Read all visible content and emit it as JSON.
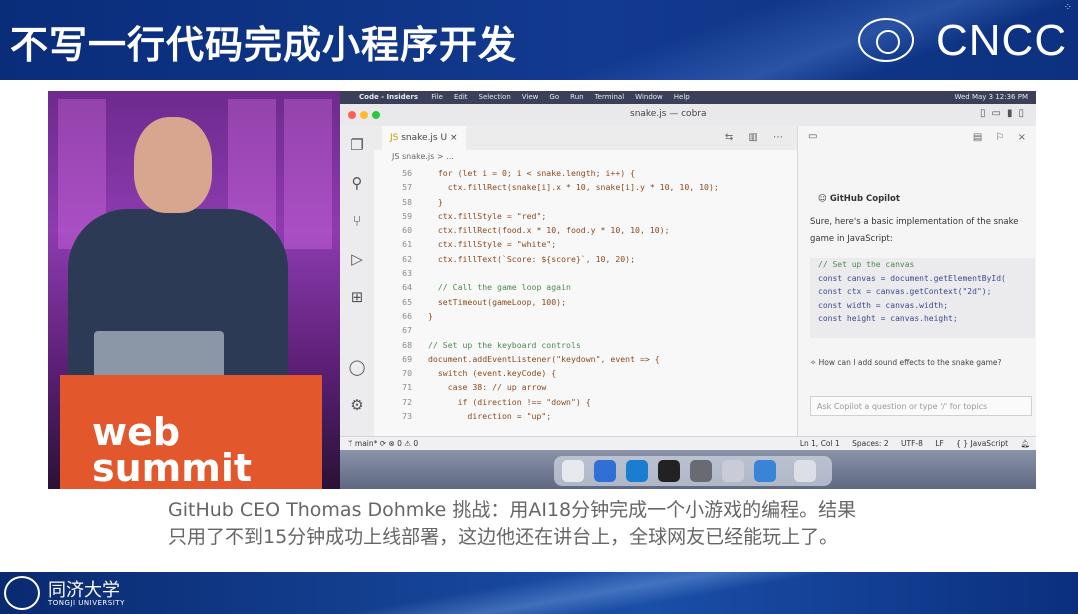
{
  "slide": {
    "title": "不写一行代码完成小程序开发",
    "conference_logo": "CNCC"
  },
  "video": {
    "podium_logo_line1": "web",
    "podium_logo_line2": "summit",
    "menubar": {
      "app": "Code - Insiders",
      "items": [
        "File",
        "Edit",
        "Selection",
        "View",
        "Go",
        "Run",
        "Terminal",
        "Window",
        "Help"
      ],
      "clock": "Wed May 3  12:36 PM"
    },
    "window_title": "snake.js — cobra",
    "tab_label": "snake.js U",
    "breadcrumb": "JS snake.js > ...",
    "code_lines": [
      {
        "num": "56",
        "text": "  for (let i = 0; i < snake.length; i++) {"
      },
      {
        "num": "57",
        "text": "    ctx.fillRect(snake[i].x * 10, snake[i].y * 10, 10, 10);"
      },
      {
        "num": "58",
        "text": "  }"
      },
      {
        "num": "59",
        "text": "  ctx.fillStyle = \"red\";"
      },
      {
        "num": "60",
        "text": "  ctx.fillRect(food.x * 10, food.y * 10, 10, 10);"
      },
      {
        "num": "61",
        "text": "  ctx.fillStyle = \"white\";"
      },
      {
        "num": "62",
        "text": "  ctx.fillText(`Score: ${score}`, 10, 20);"
      },
      {
        "num": "63",
        "text": ""
      },
      {
        "num": "64",
        "text": "  // Call the game loop again"
      },
      {
        "num": "65",
        "text": "  setTimeout(gameLoop, 100);"
      },
      {
        "num": "66",
        "text": "}"
      },
      {
        "num": "67",
        "text": ""
      },
      {
        "num": "68",
        "text": "// Set up the keyboard controls"
      },
      {
        "num": "69",
        "text": "document.addEventListener(\"keydown\", event => {"
      },
      {
        "num": "70",
        "text": "  switch (event.keyCode) {"
      },
      {
        "num": "71",
        "text": "    case 38: // up arrow"
      },
      {
        "num": "72",
        "text": "      if (direction !== \"down\") {"
      },
      {
        "num": "73",
        "text": "        direction = \"up\";"
      }
    ],
    "copilot": {
      "name": "GitHub Copilot",
      "response": "Sure, here's a basic implementation of the snake game in JavaScript:",
      "code": [
        "// Set up the canvas",
        "const canvas = document.getElementById(",
        "const ctx = canvas.getContext(\"2d\");",
        "const width = canvas.width;",
        "const height = canvas.height;"
      ],
      "question": "How can I add sound effects to the snake game?",
      "ask_placeholder": "Ask Copilot a question or type '/' for topics"
    },
    "statusbar": {
      "branch": "main*",
      "problems": "⊗ 0 ⚠ 0",
      "position": "Ln 1, Col 1",
      "spaces": "Spaces: 2",
      "encoding": "UTF-8",
      "eol": "LF",
      "language": "{ } JavaScript"
    }
  },
  "caption": {
    "line1": "GitHub CEO Thomas Dohmke 挑战：用AI18分钟完成一个小游戏的编程。结果",
    "line2": "只用了不到15分钟成功上线部署，这边他还在讲台上，全球网友已经能玩上了。"
  },
  "footer": {
    "university_name": "同济大学",
    "university_en": "TONGJI UNIVERSITY"
  }
}
